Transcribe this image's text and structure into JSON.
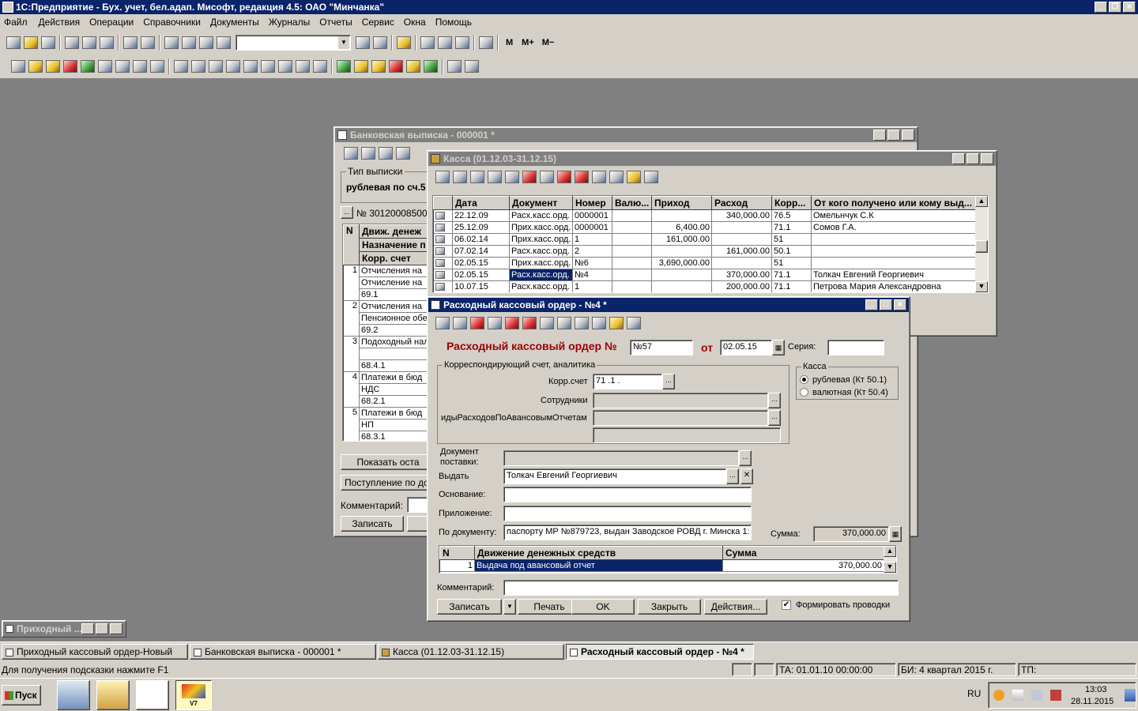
{
  "app": {
    "title": "1С:Предприятие - Бух. учет, бел.адап. Мисофт, редакция 4.5: ОАО \"Минчанка\""
  },
  "menu": [
    "Файл",
    "Действия",
    "Операции",
    "Справочники",
    "Документы",
    "Журналы",
    "Отчеты",
    "Сервис",
    "Окна",
    "Помощь"
  ],
  "toolbar": {
    "m": "M",
    "mplus": "M+",
    "mminus": "M−"
  },
  "bank": {
    "title": "Банковская выписка - 000001 *",
    "type_group": "Тип выписки",
    "type_value": "рублевая по сч.5",
    "account_label": "№ 301200085001",
    "col_n": "N",
    "col_move": "Движ. денеж",
    "col_purpose": "Назначение п",
    "col_corr": "Корр. счет",
    "rows": [
      {
        "n": "1",
        "a": "Отчисления на",
        "b": "Отчисление на",
        "c": "69.1"
      },
      {
        "n": "2",
        "a": "Отчисления на",
        "b": "Пенсионное обе",
        "c": "69.2"
      },
      {
        "n": "3",
        "a": "Подоходный нал",
        "b": "",
        "c": "68.4.1"
      },
      {
        "n": "4",
        "a": "Платежи в бюд",
        "b": "НДС",
        "c": "68.2.1"
      },
      {
        "n": "5",
        "a": "Платежи в бюд",
        "b": "НП",
        "c": "68.3.1"
      }
    ],
    "show_btn": "Показать оста",
    "receipt_btn": "Поступление по док",
    "comment_label": "Комментарий:",
    "save_btn": "Записать"
  },
  "kassa": {
    "title": "Касса (01.12.03-31.12.15)",
    "headers": [
      "Дата",
      "Документ",
      "Номер",
      "Валю...",
      "Приход",
      "Расход",
      "Корр...",
      "От кого получено или кому выд..."
    ],
    "rows": [
      [
        "22.12.09",
        "Расх.касс.орд.",
        "0000001",
        "",
        "",
        "340,000.00",
        "76.5",
        "Омельнчук С.К"
      ],
      [
        "25.12.09",
        "Прих.касс.орд.",
        "0000001",
        "",
        "6,400.00",
        "",
        "71.1",
        "Сомов Г.А."
      ],
      [
        "06.02.14",
        "Прих.касс.орд.",
        "1",
        "",
        "161,000.00",
        "",
        "51",
        ""
      ],
      [
        "07.02.14",
        "Расх.касс.орд.",
        "2",
        "",
        "",
        "161,000.00",
        "50.1",
        ""
      ],
      [
        "02.05.15",
        "Прих.касс.орд.",
        "№6",
        "",
        "3,690,000.00",
        "",
        "51",
        ""
      ],
      [
        "02.05.15",
        "Расх.касс.орд.",
        "№4",
        "",
        "",
        "370,000.00",
        "71.1",
        "Толкач Евгений Георгиевич"
      ],
      [
        "10.07.15",
        "Расх.касс.орд.",
        "1",
        "",
        "",
        "200,000.00",
        "71.1",
        "Петрова Мария Александровна"
      ]
    ]
  },
  "order": {
    "title": "Расходный кассовый ордер - №4 *",
    "heading": "Расходный кассовый ордер №",
    "number": "№57",
    "from_label": "от",
    "date": "02.05.15",
    "series_label": "Серия:",
    "series": "",
    "corr_group": "Корреспондирующий счет, аналитика",
    "corr_label": "Корр.счет",
    "corr_value": "71 .1 .",
    "employees_label": "Сотрудники",
    "advance_label": "идыРасходовПоАвансовымОтчетам",
    "kassa_group": "Касса",
    "kassa_opt1": "рублевая (Кт 50.1)",
    "kassa_opt2": "валютная (Кт 50.4)",
    "delivery_label1": "Документ",
    "delivery_label2": "поставки:",
    "issue_label": "Выдать",
    "issue_value": "Толкач Евгений Георгиевич",
    "basis_label": "Основание:",
    "attach_label": "Приложение:",
    "bydoc_label": "По документу:",
    "bydoc_value": "паспорту МР №879723, выдан Заводское РОВД г. Минска 1:",
    "sum_label": "Сумма:",
    "sum_value": "370,000.00",
    "grid_n": "N",
    "grid_move": "Движение денежных средств",
    "grid_sum": "Сумма",
    "grid_row_n": "1",
    "grid_row_move": "Выдача под авансовый отчет",
    "grid_row_sum": "370,000.00",
    "comment_label": "Комментарий:",
    "btn_save": "Записать",
    "btn_print": "Печать",
    "btn_ok": "OK",
    "btn_close": "Закрыть",
    "btn_actions": "Действия...",
    "chk_label": "Формировать проводки"
  },
  "minimized": {
    "title": "Приходный ..."
  },
  "taskbar_windows": [
    "Приходный кассовый ордер-Новый",
    "Банковская выписка - 000001 *",
    "Касса (01.12.03-31.12.15)",
    "Расходный кассовый ордер - №4 *"
  ],
  "status": {
    "hint": "Для получения подсказки нажмите F1",
    "ta": "ТА: 01.01.10  00:00:00",
    "bi": "БИ: 4 квартал 2015 г.",
    "tp": "ТП:"
  },
  "os": {
    "start": "Пуск",
    "lang": "RU",
    "time": "13:03",
    "date": "28.11.2015",
    "v7": "V7"
  }
}
